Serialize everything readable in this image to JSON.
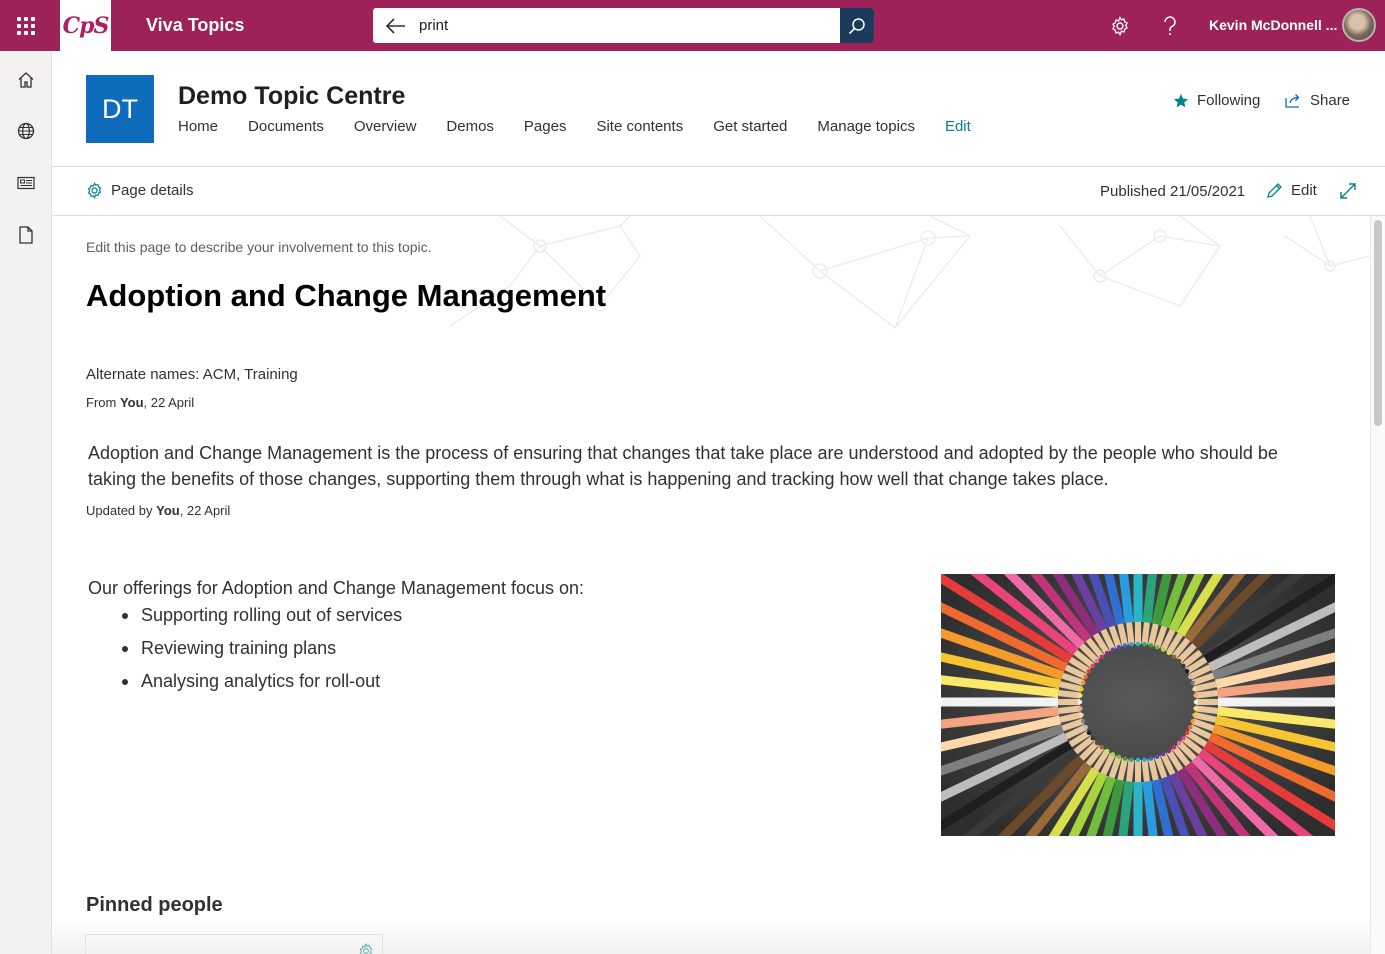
{
  "suitebar": {
    "logo_text": "CpS",
    "app_title": "Viva Topics",
    "search_value": "print",
    "user_name": "Kevin McDonnell ..."
  },
  "rail": {
    "items": [
      "home-icon",
      "globe-icon",
      "news-icon",
      "document-icon"
    ]
  },
  "site": {
    "logo_initials": "DT",
    "title": "Demo Topic Centre",
    "nav": [
      {
        "label": "Home"
      },
      {
        "label": "Documents"
      },
      {
        "label": "Overview"
      },
      {
        "label": "Demos"
      },
      {
        "label": "Pages"
      },
      {
        "label": "Site contents"
      },
      {
        "label": "Get started"
      },
      {
        "label": "Manage topics"
      },
      {
        "label": "Edit"
      }
    ],
    "following_label": "Following",
    "share_label": "Share"
  },
  "command_bar": {
    "page_details_label": "Page details",
    "published": "Published 21/05/2021",
    "edit_label": "Edit"
  },
  "topic": {
    "hint": "Edit this page to describe your involvement to this topic.",
    "title": "Adoption and Change Management",
    "alternate_names": "Alternate names: ACM, Training",
    "from_prefix": "From ",
    "from_who": "You",
    "from_date": ", 22 April",
    "description": "Adoption and Change Management is the process of ensuring that changes that take place are understood and adopted by the people who should be taking the benefits of those changes, supporting them through what is happening and tracking how well that change takes place.",
    "updated_prefix": "Updated by ",
    "updated_who": "You",
    "updated_date": ", 22 April",
    "offerings_intro": "Our offerings for Adoption and Change Management focus on:",
    "offerings": [
      "Supporting rolling out of services",
      "Reviewing training plans",
      "Analysing analytics for roll-out"
    ],
    "pinned_people_title": "Pinned people"
  },
  "colors": {
    "suitebar": "#9c2257",
    "site_logo": "#0f6cbd",
    "accent": "#038387",
    "search_button": "#1b3a5c"
  }
}
